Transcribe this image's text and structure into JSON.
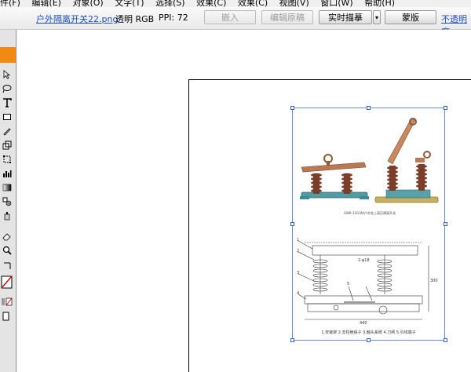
{
  "menubar": {
    "items": [
      "件(F)",
      "编辑(E)",
      "对象(O)",
      "文字(T)",
      "选择(S)",
      "效果(C)",
      "效果(C)",
      "视图(V)",
      "窗口(W)",
      "帮助(H)"
    ]
  },
  "control_bar": {
    "file_name": "户外隔离开关22.png",
    "color_mode": "透明 RGB",
    "ppi": "PPI: 72",
    "embed_button": "嵌入",
    "edit_original_button": "编辑原稿",
    "live_trace_button": "实时描摹",
    "live_trace_dropdown": "▾",
    "vectorize_button": "蒙版",
    "opacity_link": "不透明度"
  },
  "artwork": {
    "photo_caption": "GW9-12G(W)户外柱上高压隔离开关",
    "drawing_caption": "1.安装架 2.支柱绝缘子 3.触头系统 4.刀闸 5.引线端子",
    "dim_label": "2-φ18",
    "side_label": "300",
    "bottom_label": "440"
  },
  "colors": {
    "accent_orange": "#f08a12",
    "link_blue": "#1f4fb4",
    "selection_blue": "#3b64c8"
  }
}
